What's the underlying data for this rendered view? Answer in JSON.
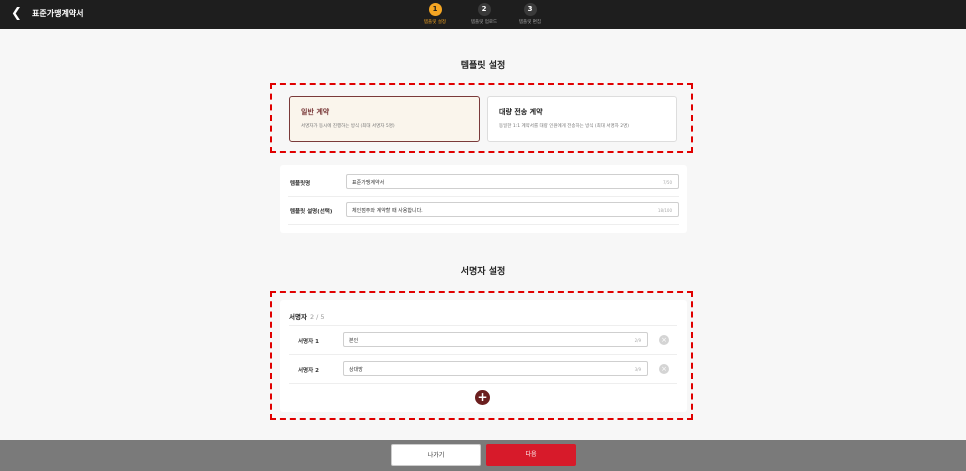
{
  "header": {
    "back_icon": "chevron-left-icon",
    "title": "표준가맹계약서",
    "steps": [
      {
        "number": "1",
        "label": "템플릿 설정",
        "active": true
      },
      {
        "number": "2",
        "label": "템플릿 업로드",
        "active": false
      },
      {
        "number": "3",
        "label": "템플릿 편집",
        "active": false
      }
    ]
  },
  "template_section": {
    "heading": "템플릿 설정",
    "types": [
      {
        "title": "일반 계약",
        "desc": "서명자가 동시에 진행하는 방식 (최대 서명자 5명)",
        "selected": true
      },
      {
        "title": "대량 전송 계약",
        "desc": "동일한 1:1 계약서를 대량 인원에게 전송하는 방식 (최대 서명자 2명)",
        "selected": false
      }
    ],
    "name_label": "템플릿명",
    "name_value": "표준가맹계약서",
    "name_count": "7/50",
    "desc_label": "템플릿 설명(선택)",
    "desc_value": "체인점주와 계약할 때 사용합니다.",
    "desc_count": "18/100"
  },
  "signer_section": {
    "heading": "서명자 설정",
    "title": "서명자",
    "count": "2 / 5",
    "signers": [
      {
        "label": "서명자 1",
        "value": "본인",
        "count": "2/9"
      },
      {
        "label": "서명자 2",
        "value": "상대방",
        "count": "3/9"
      }
    ],
    "remove_icon": "close-circle-icon",
    "add_icon": "plus-circle-icon"
  },
  "footer": {
    "prev_label": "나가기",
    "next_label": "다음"
  },
  "colors": {
    "accent": "#d71a2a",
    "step_active": "#f5a623",
    "selected_card": "#7a3a3a",
    "highlight": "#e00000"
  }
}
